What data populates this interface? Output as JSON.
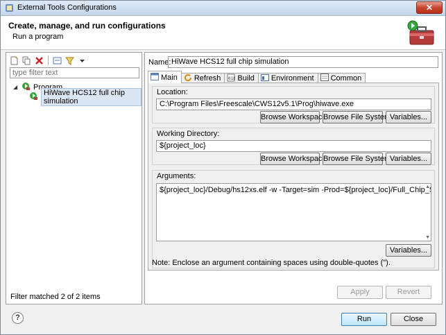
{
  "window": {
    "title": "External Tools Configurations",
    "close_icon": "close-icon"
  },
  "header": {
    "title": "Create, manage, and run configurations",
    "subtitle": "Run a program"
  },
  "left": {
    "filter_placeholder": "type filter text",
    "tree": {
      "category": "Program",
      "item": "HiWave HCS12 full chip simulation"
    },
    "status": "Filter matched 2 of 2 items"
  },
  "right": {
    "name_label": "Name:",
    "name_value": "HiWave HCS12 full chip simulation",
    "tabs": [
      {
        "label": "Main",
        "icon": "main-tab-icon"
      },
      {
        "label": "Refresh",
        "icon": "refresh-icon"
      },
      {
        "label": "Build",
        "icon": "build-icon"
      },
      {
        "label": "Environment",
        "icon": "environment-icon"
      },
      {
        "label": "Common",
        "icon": "common-icon"
      }
    ],
    "location": {
      "label": "Location:",
      "value": "C:\\Program Files\\Freescale\\CWS12v5.1\\Prog\\hiwave.exe",
      "browse_workspace": "Browse Workspace...",
      "browse_fs": "Browse File System...",
      "variables": "Variables..."
    },
    "workdir": {
      "label": "Working Directory:",
      "value": "${project_loc}",
      "browse_workspace": "Browse Workspace...",
      "browse_fs": "Browse File System...",
      "variables": "Variables..."
    },
    "arguments": {
      "label": "Arguments:",
      "value": "${project_loc}/Debug/hs12xs.elf -w -Target=sim -Prod=${project_loc}/Full_Chip_Simulation.ini",
      "variables": "Variables..."
    },
    "note": "Note: Enclose an argument containing spaces using double-quotes (\").",
    "apply": "Apply",
    "revert": "Revert"
  },
  "footer": {
    "help": "?",
    "run": "Run",
    "close": "Close"
  }
}
